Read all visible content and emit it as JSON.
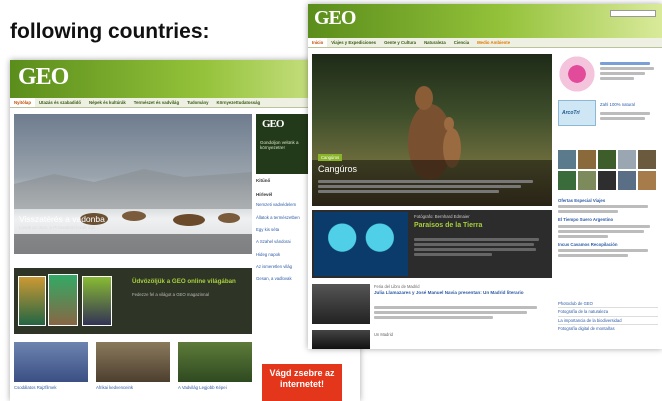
{
  "heading": "following countries:",
  "hungary": {
    "logo": "GEO",
    "nav": [
      "Nyitólap",
      "Utazás és szabadidő",
      "Népek és kultúrák",
      "Természet és vadvilág",
      "Tudomány",
      "Környezettudatosság"
    ],
    "hero_title": "Visszatérés a vadonba",
    "hero_sub": "Lovak az úton, a Przewalski-lovak útja...",
    "side_promo": "Gondoljon velünk a környezetre!",
    "side_items": [
      "Kitűnő",
      "Hírlevél",
      "Nemzeti vadvédelem",
      "Állatok a természetben",
      "Egy kis séta",
      "A Szahel vándorai",
      "Hideg napok",
      "Az ismeretlen világ",
      "Gesan, a vadlovak"
    ],
    "welcome_title": "Üdvözöljük a GEO online világában",
    "welcome_sub": "Fedezze fel a világot a GEO magazinnal",
    "thumbs": [
      "Csodálatos Rajzfilmek",
      "Afrikai kedvenceink",
      "A Vadvilág Legjobb Képei"
    ],
    "ad_text": "Vágd zsebre az internetet!"
  },
  "spain": {
    "logo": "GEO",
    "nav": [
      "Inicio",
      "Viajes y Expediciones",
      "Gente y Cultura",
      "Naturaleza",
      "Ciencia",
      "Medio Ambiente"
    ],
    "hero_badge": "Cangúros",
    "hero_title": "Cangúros",
    "feature_title": "Paraísos de la Tierra",
    "feature_kicker": "Fotógrafo: Bernhard Edmaier",
    "news_kicker": "Feria del Libro de Madrid",
    "news_title": "Julia Llamazares y José Manuel Navia presentan: Un Madrid literario",
    "news_kicker2": "Un Madrid",
    "right_links": [
      "Ofertas Especial Viajes",
      "El Tiempo Suero Argentino",
      "Incus Cavamos Recopilación"
    ],
    "right_list": [
      "Photoclub de GEO",
      "Fotografía de la naturaleza",
      "La importancia de la biodiversidad",
      "Fotografía digital de montañas"
    ],
    "ad_label": "Zahl 100% natural",
    "sponsor_label": "ArcoTri"
  }
}
